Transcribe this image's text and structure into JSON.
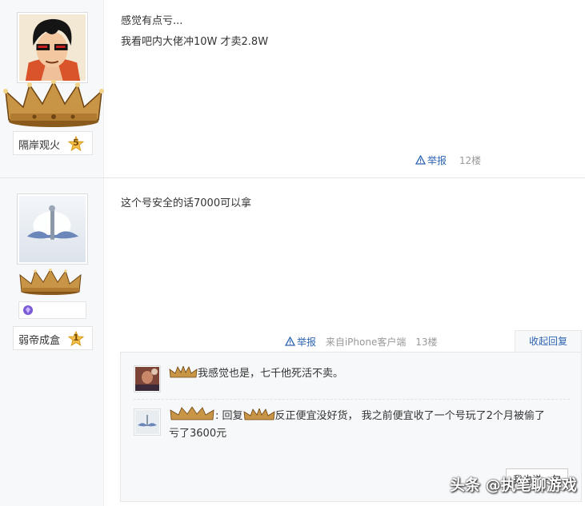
{
  "posts": [
    {
      "username": "隔岸观火",
      "level": "5",
      "lines": [
        "感觉有点亏...",
        "我看吧内大佬冲10W 才卖2.8W"
      ],
      "report_label": "举报",
      "floor": "12楼"
    },
    {
      "username": "弱帝成盒",
      "level": "1",
      "lines": [
        "这个号安全的话7000可以拿"
      ],
      "report_label": "举报",
      "source": "来自iPhone客户端",
      "floor": "13楼",
      "fold_label": "收起回复",
      "replies": [
        {
          "text": "我感觉也是，七千他死活不卖。"
        },
        {
          "prefix": ": 回复",
          "text_line1": "反正便宜没好货， 我之前便宜收了一个号玩了2个月被偷了",
          "text_line2": "亏了3600元"
        }
      ],
      "say_label": "我也说一句"
    }
  ],
  "watermark": "头条 @执笔聊游戏",
  "colors": {
    "link": "#2d64b3",
    "sidebar_bg": "#f7f8fa",
    "reply_bg": "#f7f8fa",
    "star": "#f5c14a"
  }
}
